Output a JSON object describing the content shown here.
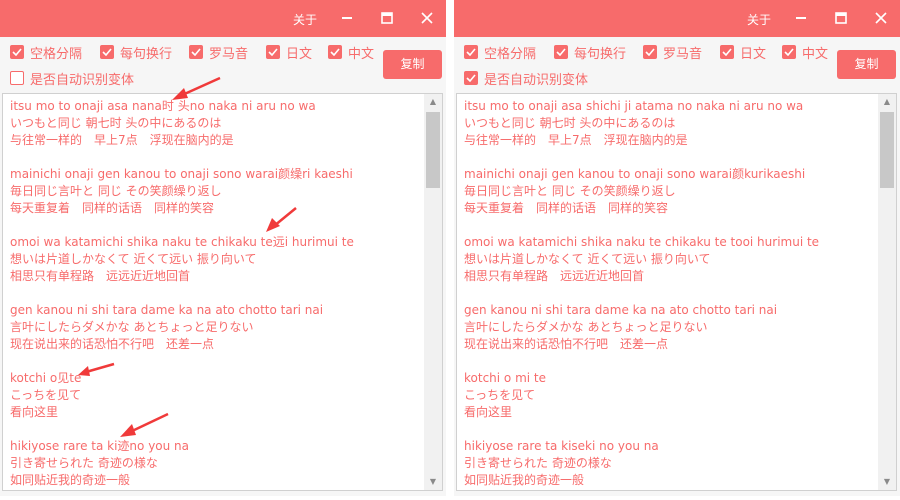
{
  "left_window": {
    "title": "关于",
    "options": [
      {
        "label": "空格分隔",
        "checked": true
      },
      {
        "label": "每句换行",
        "checked": true
      },
      {
        "label": "罗马音",
        "checked": true
      },
      {
        "label": "日文",
        "checked": true
      },
      {
        "label": "中文",
        "checked": true
      },
      {
        "label": "是否自动识别变体",
        "checked": false
      }
    ],
    "copy_label": "复制",
    "lines": [
      "itsu mo to onaji asa nana时 头no naka ni aru no wa",
      "いつもと同じ 朝七时 头の中にあるのは",
      "与往常一样的　早上7点　浮现在脑内的是",
      "",
      "mainichi onaji gen kanou to onaji sono warai颜缲ri kaeshi",
      "毎日同じ言叶と 同じ その笑颜缲り返し",
      "每天重复着　同样的话语　同样的笑容",
      "",
      "omoi wa katamichi shika naku te chikaku te远i hurimui te",
      "想いは片道しかなくて 近くて远い 振り向いて",
      "相思只有单程路　远远近近地回首",
      "",
      "gen kanou ni shi tara dame ka na ato chotto tari nai",
      "言叶にしたらダメかな あとちょっと足りない",
      "现在说出来的话恐怕不行吧　还差一点",
      "",
      "kotchi o见te",
      "こっちを见て",
      "看向这里",
      "",
      "hikiyose rare ta ki迹no you na",
      "引き寄せられた 奇迹の様な",
      "如同贴近我的奇迹一般"
    ]
  },
  "right_window": {
    "title": "关于",
    "options": [
      {
        "label": "空格分隔",
        "checked": true
      },
      {
        "label": "每句换行",
        "checked": true
      },
      {
        "label": "罗马音",
        "checked": true
      },
      {
        "label": "日文",
        "checked": true
      },
      {
        "label": "中文",
        "checked": true
      },
      {
        "label": "是否自动识别变体",
        "checked": true
      }
    ],
    "copy_label": "复制",
    "lines": [
      "itsu mo to onaji asa shichi ji atama no naka ni aru no wa",
      "いつもと同じ 朝七时 头の中にあるのは",
      "与往常一样的　早上7点　浮现在脑内的是",
      "",
      "mainichi onaji gen kanou to onaji sono warai颜kurikaeshi",
      "毎日同じ言叶と 同じ その笑颜缲り返し",
      "每天重复着　同样的话语　同样的笑容",
      "",
      "omoi wa katamichi shika naku te chikaku te tooi hurimui te",
      "想いは片道しかなくて 近くて远い 振り向いて",
      "相思只有单程路　远远近近地回首",
      "",
      "gen kanou ni shi tara dame ka na ato chotto tari nai",
      "言叶にしたらダメかな あとちょっと足りない",
      "现在说出来的话恐怕不行吧　还差一点",
      "",
      "kotchi o mi te",
      "こっちを见て",
      "看向这里",
      "",
      "hikiyose rare ta kiseki no you na",
      "引き寄せられた 奇迹の様な",
      "如同贴近我的奇迹一般"
    ]
  },
  "accent_color": "#f76b6b",
  "icons": [
    "minimize-icon",
    "maximize-icon",
    "close-icon",
    "checkbox-check-icon",
    "scroll-up-icon",
    "scroll-down-icon",
    "red-arrow-annotation"
  ]
}
